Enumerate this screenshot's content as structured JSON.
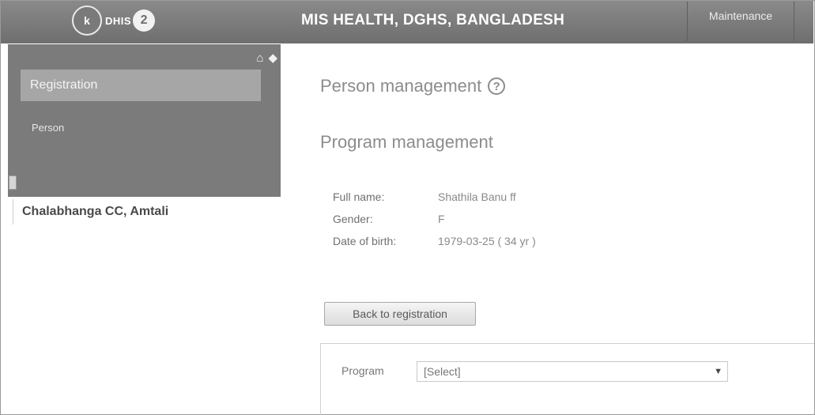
{
  "header": {
    "logo_seal": "k",
    "logo_text": "DHIS",
    "logo_badge": "2",
    "title": "MIS HEALTH, DGHS, BANGLADESH",
    "maintenance_label": "Maintenance"
  },
  "sidebar": {
    "icons": [
      "home-icon",
      "arrow-left-icon"
    ],
    "section_label": "Registration",
    "items": [
      {
        "label": "Person"
      }
    ]
  },
  "org_unit": "Chalabhanga CC, Amtali",
  "main": {
    "person_management_title": "Person management",
    "help_glyph": "?",
    "program_management_title": "Program management",
    "person": {
      "full_name_label": "Full name:",
      "full_name": "Shathila Banu ff",
      "gender_label": "Gender:",
      "gender": "F",
      "dob_label": "Date of birth:",
      "dob": "1979-03-25 ( 34 yr )"
    },
    "back_button": "Back to registration",
    "program_label": "Program",
    "program_select_value": "[Select]"
  },
  "colors": {
    "header_bg": "#7a7a7a",
    "sidebar_bg": "#7b7b7b",
    "active_item_bg": "#a6a6a6"
  }
}
